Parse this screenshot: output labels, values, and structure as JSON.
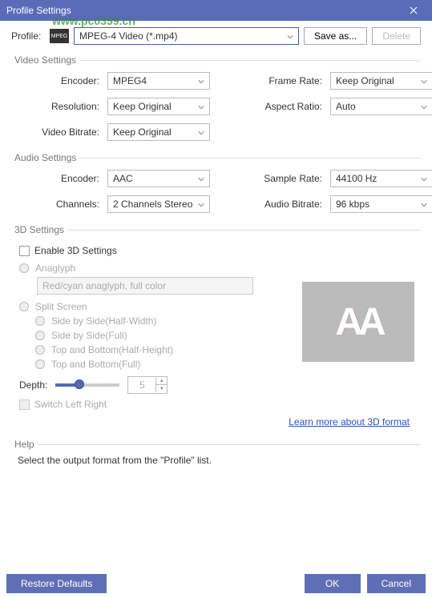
{
  "titlebar": {
    "title": "Profile Settings"
  },
  "profile": {
    "label": "Profile:",
    "value": "MPEG-4 Video (*.mp4)",
    "save_label": "Save as...",
    "delete_label": "Delete",
    "icon_text": "MPEG"
  },
  "watermark": {
    "url": "www.pc0359.cn"
  },
  "video": {
    "legend": "Video Settings",
    "encoder_label": "Encoder:",
    "encoder_value": "MPEG4",
    "resolution_label": "Resolution:",
    "resolution_value": "Keep Original",
    "bitrate_label": "Video Bitrate:",
    "bitrate_value": "Keep Original",
    "framerate_label": "Frame Rate:",
    "framerate_value": "Keep Original",
    "aspect_label": "Aspect Ratio:",
    "aspect_value": "Auto"
  },
  "audio": {
    "legend": "Audio Settings",
    "encoder_label": "Encoder:",
    "encoder_value": "AAC",
    "channels_label": "Channels:",
    "channels_value": "2 Channels Stereo",
    "samplerate_label": "Sample Rate:",
    "samplerate_value": "44100 Hz",
    "bitrate_label": "Audio Bitrate:",
    "bitrate_value": "96 kbps"
  },
  "three_d": {
    "legend": "3D Settings",
    "enable_label": "Enable 3D Settings",
    "anaglyph_label": "Anaglyph",
    "anaglyph_select": "Red/cyan anaglyph, full color",
    "split_label": "Split Screen",
    "sbs_half": "Side by Side(Half-Width)",
    "sbs_full": "Side by Side(Full)",
    "tab_half": "Top and Bottom(Half-Height)",
    "tab_full": "Top and Bottom(Full)",
    "depth_label": "Depth:",
    "depth_value": "5",
    "switch_label": "Switch Left Right",
    "learn_more": "Learn more about 3D format"
  },
  "help": {
    "legend": "Help",
    "text": "Select the output format from the \"Profile\" list."
  },
  "buttons": {
    "restore": "Restore Defaults",
    "ok": "OK",
    "cancel": "Cancel"
  }
}
